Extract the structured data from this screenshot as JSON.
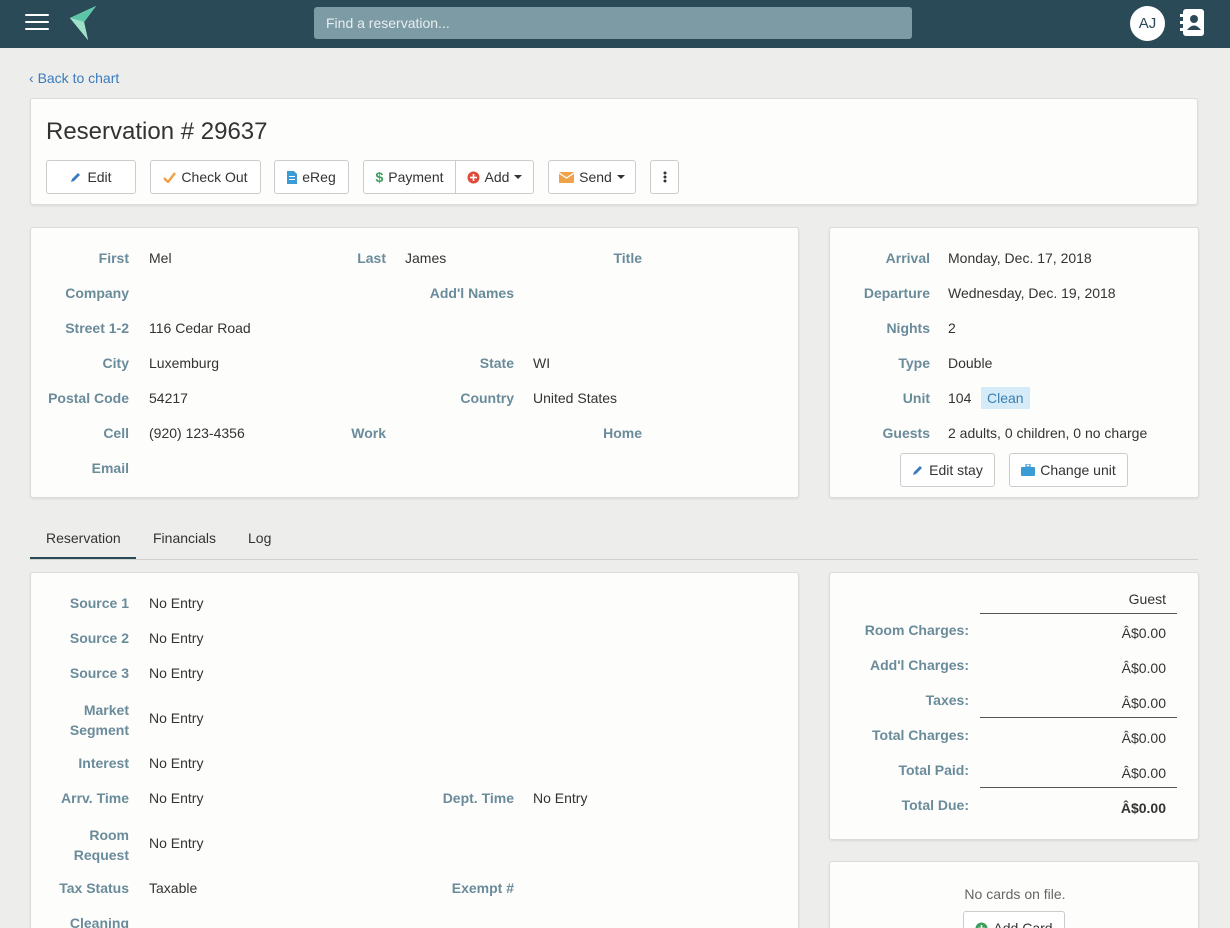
{
  "header": {
    "search_placeholder": "Find a reservation...",
    "avatar_initials": "AJ"
  },
  "nav": {
    "back_label": "Back to chart"
  },
  "reservation": {
    "title": "Reservation # 29637",
    "actions": {
      "edit": "Edit",
      "checkout": "Check Out",
      "ereg": "eReg",
      "payment": "Payment",
      "add": "Add",
      "send": "Send"
    }
  },
  "guest": {
    "labels": {
      "first": "First",
      "last": "Last",
      "title": "Title",
      "company": "Company",
      "addl_names": "Add'l Names",
      "street": "Street 1-2",
      "city": "City",
      "state": "State",
      "postal": "Postal Code",
      "country": "Country",
      "cell": "Cell",
      "work": "Work",
      "home": "Home",
      "email": "Email"
    },
    "first": "Mel",
    "last": "James",
    "street": "116 Cedar Road",
    "city": "Luxemburg",
    "state": "WI",
    "postal": "54217",
    "country": "United States",
    "cell": "(920) 123-4356"
  },
  "stay": {
    "labels": {
      "arrival": "Arrival",
      "departure": "Departure",
      "nights": "Nights",
      "type": "Type",
      "unit": "Unit",
      "guests": "Guests"
    },
    "arrival": "Monday, Dec. 17, 2018",
    "departure": "Wednesday, Dec. 19, 2018",
    "nights": "2",
    "type": "Double",
    "unit": "104",
    "unit_status": "Clean",
    "guests": "2 adults, 0 children, 0 no charge",
    "edit_stay": "Edit stay",
    "change_unit": "Change unit"
  },
  "tabs": [
    "Reservation",
    "Financials",
    "Log"
  ],
  "details": {
    "labels": {
      "source1": "Source 1",
      "source2": "Source 2",
      "source3": "Source 3",
      "market_1": "Market",
      "market_2": "Segment",
      "interest": "Interest",
      "arrv_time": "Arrv. Time",
      "dept_time": "Dept. Time",
      "room_1": "Room",
      "room_2": "Request",
      "tax_status": "Tax Status",
      "exempt": "Exempt #",
      "cleaning": "Cleaning"
    },
    "source1": "No Entry",
    "source2": "No Entry",
    "source3": "No Entry",
    "market": "No Entry",
    "interest": "No Entry",
    "arrv_time": "No Entry",
    "dept_time": "No Entry",
    "room_request": "No Entry",
    "tax_status": "Taxable"
  },
  "financials": {
    "column": "Guest",
    "labels": {
      "room": "Room Charges:",
      "addl": "Add'l Charges:",
      "taxes": "Taxes:",
      "total_charges": "Total Charges:",
      "total_paid": "Total Paid:",
      "total_due": "Total Due:"
    },
    "room": "Â$0.00",
    "addl": "Â$0.00",
    "taxes": "Â$0.00",
    "total_charges": "Â$0.00",
    "total_paid": "Â$0.00",
    "total_due": "Â$0.00"
  },
  "cards": {
    "empty": "No cards on file.",
    "add_card": "Add Card"
  },
  "colors": {
    "topbar": "#2b4a57",
    "label": "#6a8b9a",
    "link": "#3a7bbf",
    "chip_bg": "#d5ebf8"
  }
}
